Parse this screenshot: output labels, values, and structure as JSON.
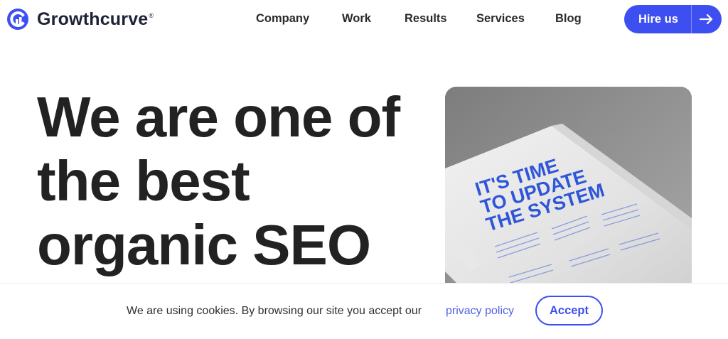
{
  "header": {
    "brand": "Growthcurve",
    "brand_mark": "®",
    "nav": [
      {
        "label": "Company"
      },
      {
        "label": "Work"
      },
      {
        "label": "Results"
      },
      {
        "label": "Services"
      },
      {
        "label": "Blog"
      }
    ],
    "cta_label": "Hire us",
    "cta_icon": "arrow-right-icon"
  },
  "hero": {
    "title_lines": [
      "We are one of",
      "the best",
      "organic SEO"
    ],
    "image": {
      "poster_headline": [
        "IT'S TIME",
        "TO UPDATE",
        "THE SYSTEM"
      ],
      "poster_color": "#2f55d9"
    }
  },
  "cookie": {
    "text": "We are using cookies. By browsing our site you accept our",
    "link": "privacy policy",
    "accept_label": "Accept"
  },
  "colors": {
    "accent": "#3e4ff2",
    "link": "#5261e6",
    "text": "#222222"
  }
}
